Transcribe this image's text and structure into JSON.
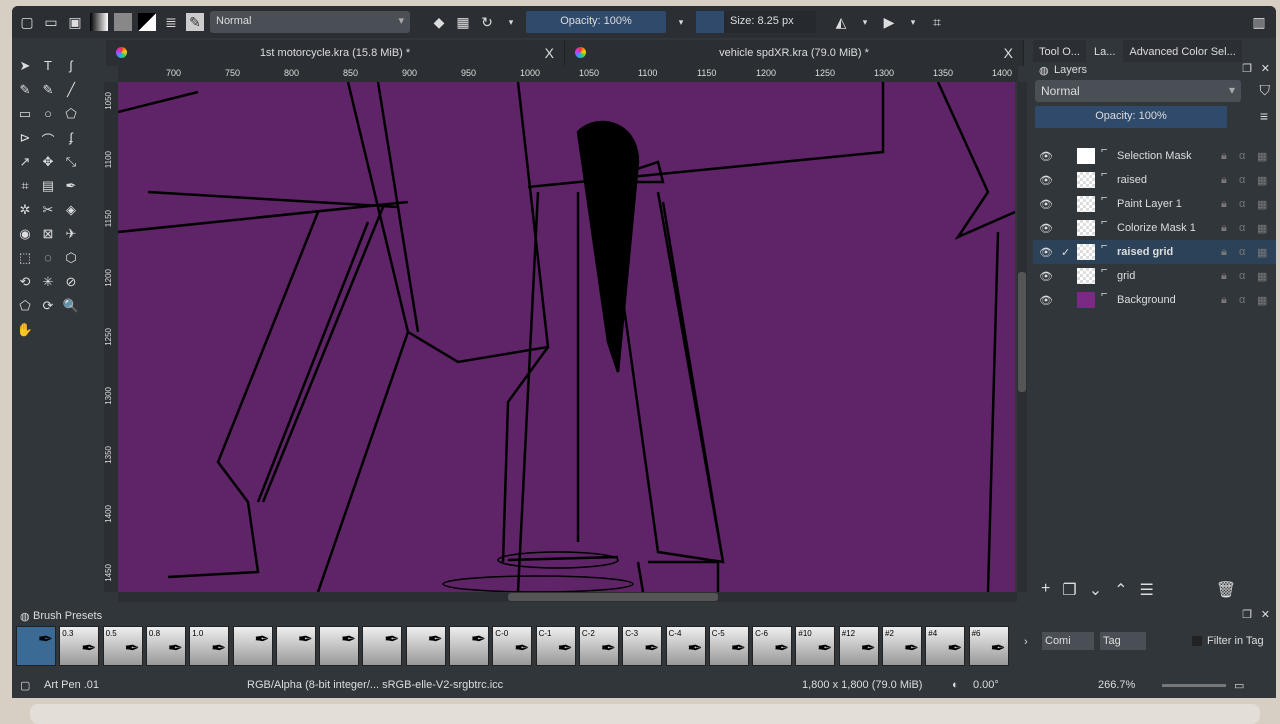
{
  "toolbar": {
    "blend_mode": "Normal",
    "opacity": "Opacity: 100%",
    "size": "Size: 8.25 px"
  },
  "tabs": [
    {
      "label": "1st motorcycle.kra (15.8 MiB) *",
      "close": "X"
    },
    {
      "label": "vehicle spdXR.kra (79.0 MiB) *",
      "close": "X"
    }
  ],
  "ruler_top": [
    "700",
    "750",
    "800",
    "850",
    "900",
    "950",
    "1000",
    "1050",
    "1100",
    "1150",
    "1200",
    "1250",
    "1300",
    "1350",
    "1400"
  ],
  "ruler_left": [
    "1050",
    "1100",
    "1150",
    "1200",
    "1250",
    "1300",
    "1350",
    "1400",
    "1450"
  ],
  "canvas_color": "#5f2367",
  "right_tabs": [
    "Tool O...",
    "La...",
    "Advanced Color Sel..."
  ],
  "layers_panel": {
    "title": "Layers",
    "blend_mode": "Normal",
    "opacity": "Opacity:  100%",
    "layers": [
      {
        "name": "Selection Mask",
        "selected": false
      },
      {
        "name": "raised",
        "selected": false
      },
      {
        "name": "Paint Layer 1",
        "selected": false
      },
      {
        "name": "Colorize Mask 1",
        "selected": false
      },
      {
        "name": "raised grid",
        "selected": true
      },
      {
        "name": "grid",
        "selected": false
      },
      {
        "name": "Background",
        "selected": false
      }
    ]
  },
  "brush_presets": {
    "title": "Brush Presets",
    "labels": [
      "",
      "0.3",
      "0.5",
      "0.8",
      "1.0",
      "",
      "",
      "",
      "",
      "",
      "",
      "C-0",
      "C-1",
      "C-2",
      "C-3",
      "C-4",
      "C-5",
      "C-6",
      "#10",
      "#12",
      "#2",
      "#4",
      "#6"
    ],
    "tag_filter": "Comi",
    "tag_label": "Tag",
    "filter_label": "Filter in Tag"
  },
  "status": {
    "brush": "Art Pen .01",
    "color_profile": "RGB/Alpha (8-bit integer/... sRGB-elle-V2-srgbtrc.icc",
    "dimensions": "1,800 x 1,800 (79.0 MiB)",
    "rotation": "0.00°",
    "zoom": "266.7%"
  }
}
